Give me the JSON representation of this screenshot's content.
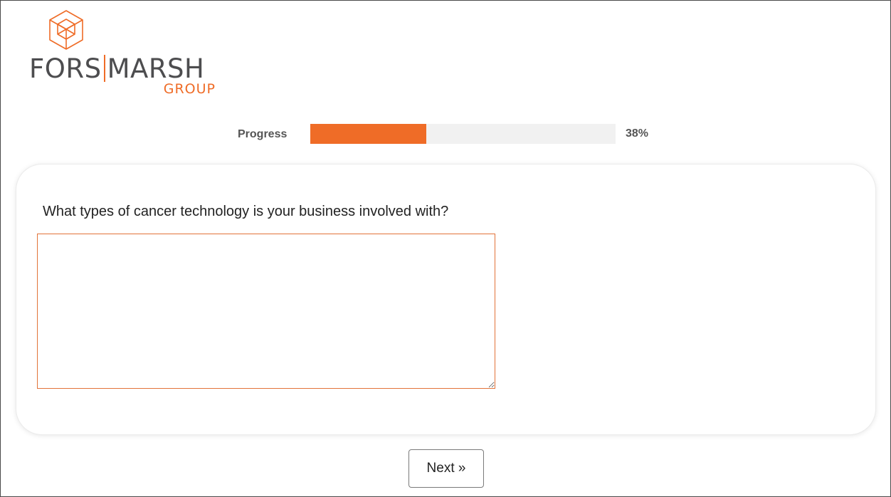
{
  "logo": {
    "icon": "cube-outline-logo-icon",
    "main_left": "FORS",
    "main_right": "MARSH",
    "sub": "GROUP",
    "accent_color": "#ef6c27",
    "text_color": "#4d4d4f"
  },
  "progress": {
    "label": "Progress",
    "value_text": "38%",
    "value": 0.38,
    "fill_color": "#ef6c27",
    "track_color": "#f1f1f1"
  },
  "question": {
    "text": "What types of cancer technology is your business involved with?",
    "answer_value": "",
    "border_color": "#e27339"
  },
  "navigation": {
    "next_label": "Next »"
  }
}
